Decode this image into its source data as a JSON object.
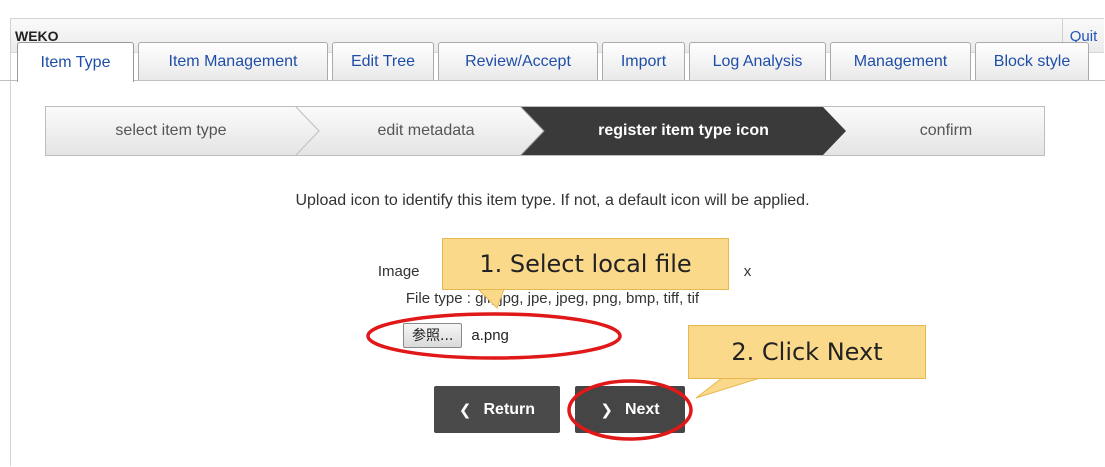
{
  "app": {
    "title": "WEKO",
    "quit_label": "Quit"
  },
  "tabs": [
    {
      "label": "Item Type",
      "active": true
    },
    {
      "label": "Item Management",
      "active": false
    },
    {
      "label": "Edit Tree",
      "active": false
    },
    {
      "label": "Review/Accept",
      "active": false
    },
    {
      "label": "Import",
      "active": false
    },
    {
      "label": "Log Analysis",
      "active": false
    },
    {
      "label": "Management",
      "active": false
    },
    {
      "label": "Block style",
      "active": false
    }
  ],
  "steps": [
    {
      "label": "select item type",
      "active": false
    },
    {
      "label": "edit metadata",
      "active": false
    },
    {
      "label": "register item type icon",
      "active": true
    },
    {
      "label": "confirm",
      "active": false
    }
  ],
  "content": {
    "instruction": "Upload icon to identify this item type. If not, a default icon will be applied.",
    "image_size_prefix": "Image",
    "image_size_suffix": "x",
    "file_type": "File type : gif, jpg, jpe, jpeg, png, bmp, tiff, tif",
    "browse_label": "参照...",
    "file_name": "a.png"
  },
  "buttons": {
    "return_label": "Return",
    "next_label": "Next"
  },
  "annotations": {
    "callout_1": "1. Select local file",
    "callout_2": "2. Click Next"
  },
  "colors": {
    "accent_link": "#1f4ea8",
    "active_step": "#3a3a3a",
    "callout_fill": "#fbd98b",
    "highlight_ring": "#e01818"
  }
}
